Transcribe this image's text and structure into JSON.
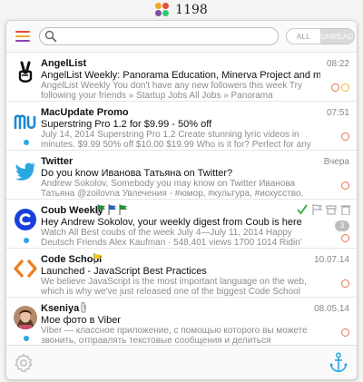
{
  "app": {
    "counter": "1198",
    "dot_colors": [
      "#f5a623",
      "#e74c3c",
      "#7b4ea3",
      "#2ecc71"
    ],
    "menu_colors": [
      "#e74c3c",
      "#f5a623",
      "#8e44ad"
    ]
  },
  "toolbar": {
    "search_placeholder": "",
    "filter_all": "ALL",
    "filter_unread": "UNREAD",
    "active_filter": "unread"
  },
  "emails": [
    {
      "sender": "AngelList",
      "subject": "AngelList Weekly: Panorama Education, Minerva Project and more st…",
      "preview": "AngelList Weekly You don't have any new followers this week Try following your friends » Startup Jobs All Jobs » Panorama Education Helping schoo…",
      "date": "08:22",
      "icon": "victory-hand-icon",
      "unread_dot": false,
      "rings": [
        "orange",
        "yellow"
      ]
    },
    {
      "sender": "MacUpdate Promo",
      "subject": "Superstring Pro 1.2 for $9.99 - 50% off",
      "preview": "July 14, 2014 Superstring Pro 1.2 Create stunning lyric videos in minutes. $9.99 50% off $10.00 $19.99 Who is it for? Perfect for any music lover! R…",
      "date": "07:51",
      "icon": "mu-logo-icon",
      "unread_dot": true,
      "rings": [
        "orange"
      ]
    },
    {
      "sender": "Twitter",
      "subject": "Do you know Иванова Татьяна  on Twitter?",
      "preview": "Andrew Sokolov, Somebody you may know on Twitter Иванова Татьяна @zoilovna Увлечения - #юмор, #культура, #искусство, #творческие к…",
      "date": "Вчера",
      "icon": "twitter-bird-icon",
      "unread_dot": false,
      "rings": [
        "orange"
      ]
    },
    {
      "sender": "Coub Weekly",
      "subject": "Hey Andrew Sokolov, your weekly digest from Coub is here",
      "preview": "Watch All Best coubs of the week July 4—July 11, 2014 Happy Deutsch Friends Alex Kaufman · 548,401 views 1700 1014 Ridin' like a boss 299…",
      "date": "",
      "icon": "coub-logo-icon",
      "unread_dot": true,
      "rings": [
        "orange"
      ],
      "badge": "3",
      "flags": [
        "#2a8c3a",
        "#2b5fbf",
        "#2a8c3a"
      ]
    },
    {
      "sender": "Code School",
      "subject": "Launched - JavaScript Best Practices",
      "preview": "We believe JavaScript is the most important language on the web, which is why we've just released one of the biggest Code School courses to date,…",
      "date": "10.07.14",
      "icon": "code-brackets-icon",
      "unread_dot": false,
      "rings": [
        "orange"
      ],
      "flags": [
        "#f2c811"
      ]
    },
    {
      "sender": "Kseniya",
      "subject": "Мое фото в Viber",
      "preview": "Viber — классное приложение, с помощью которого вы можете звонить, отправлять текстовые сообщения и делиться фотографиям…",
      "date": "08.05.14",
      "icon": "avatar-photo",
      "unread_dot": true,
      "rings": [
        "orange"
      ],
      "attachment": true
    }
  ]
}
